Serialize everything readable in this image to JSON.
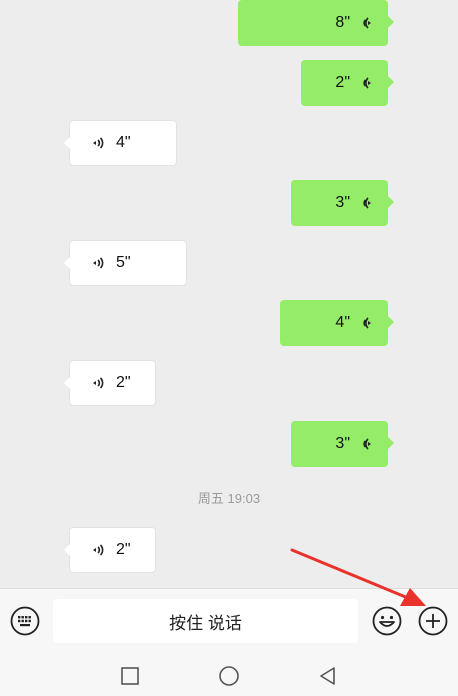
{
  "messages": [
    {
      "direction": "out",
      "duration": "8\""
    },
    {
      "direction": "out",
      "duration": "2\""
    },
    {
      "direction": "in",
      "duration": "4\""
    },
    {
      "direction": "out",
      "duration": "3\""
    },
    {
      "direction": "in",
      "duration": "5\""
    },
    {
      "direction": "out",
      "duration": "4\""
    },
    {
      "direction": "in",
      "duration": "2\""
    },
    {
      "direction": "out",
      "duration": "3\""
    },
    {
      "direction": "in",
      "duration": "2\""
    }
  ],
  "timestamp": "周五 19:03",
  "input_bar": {
    "hold_to_talk_label": "按住 说话",
    "keyboard_icon": "keyboard-icon",
    "emoji_icon": "emoji-icon",
    "plus_icon": "plus-icon"
  },
  "nav_bar": {
    "icons": [
      "square-icon",
      "circle-icon",
      "back-triangle-icon"
    ]
  },
  "colors": {
    "outgoing_bubble": "#95ec69",
    "incoming_bubble": "#ffffff",
    "chat_background": "#ededed",
    "annotation_arrow": "#e8322b"
  }
}
